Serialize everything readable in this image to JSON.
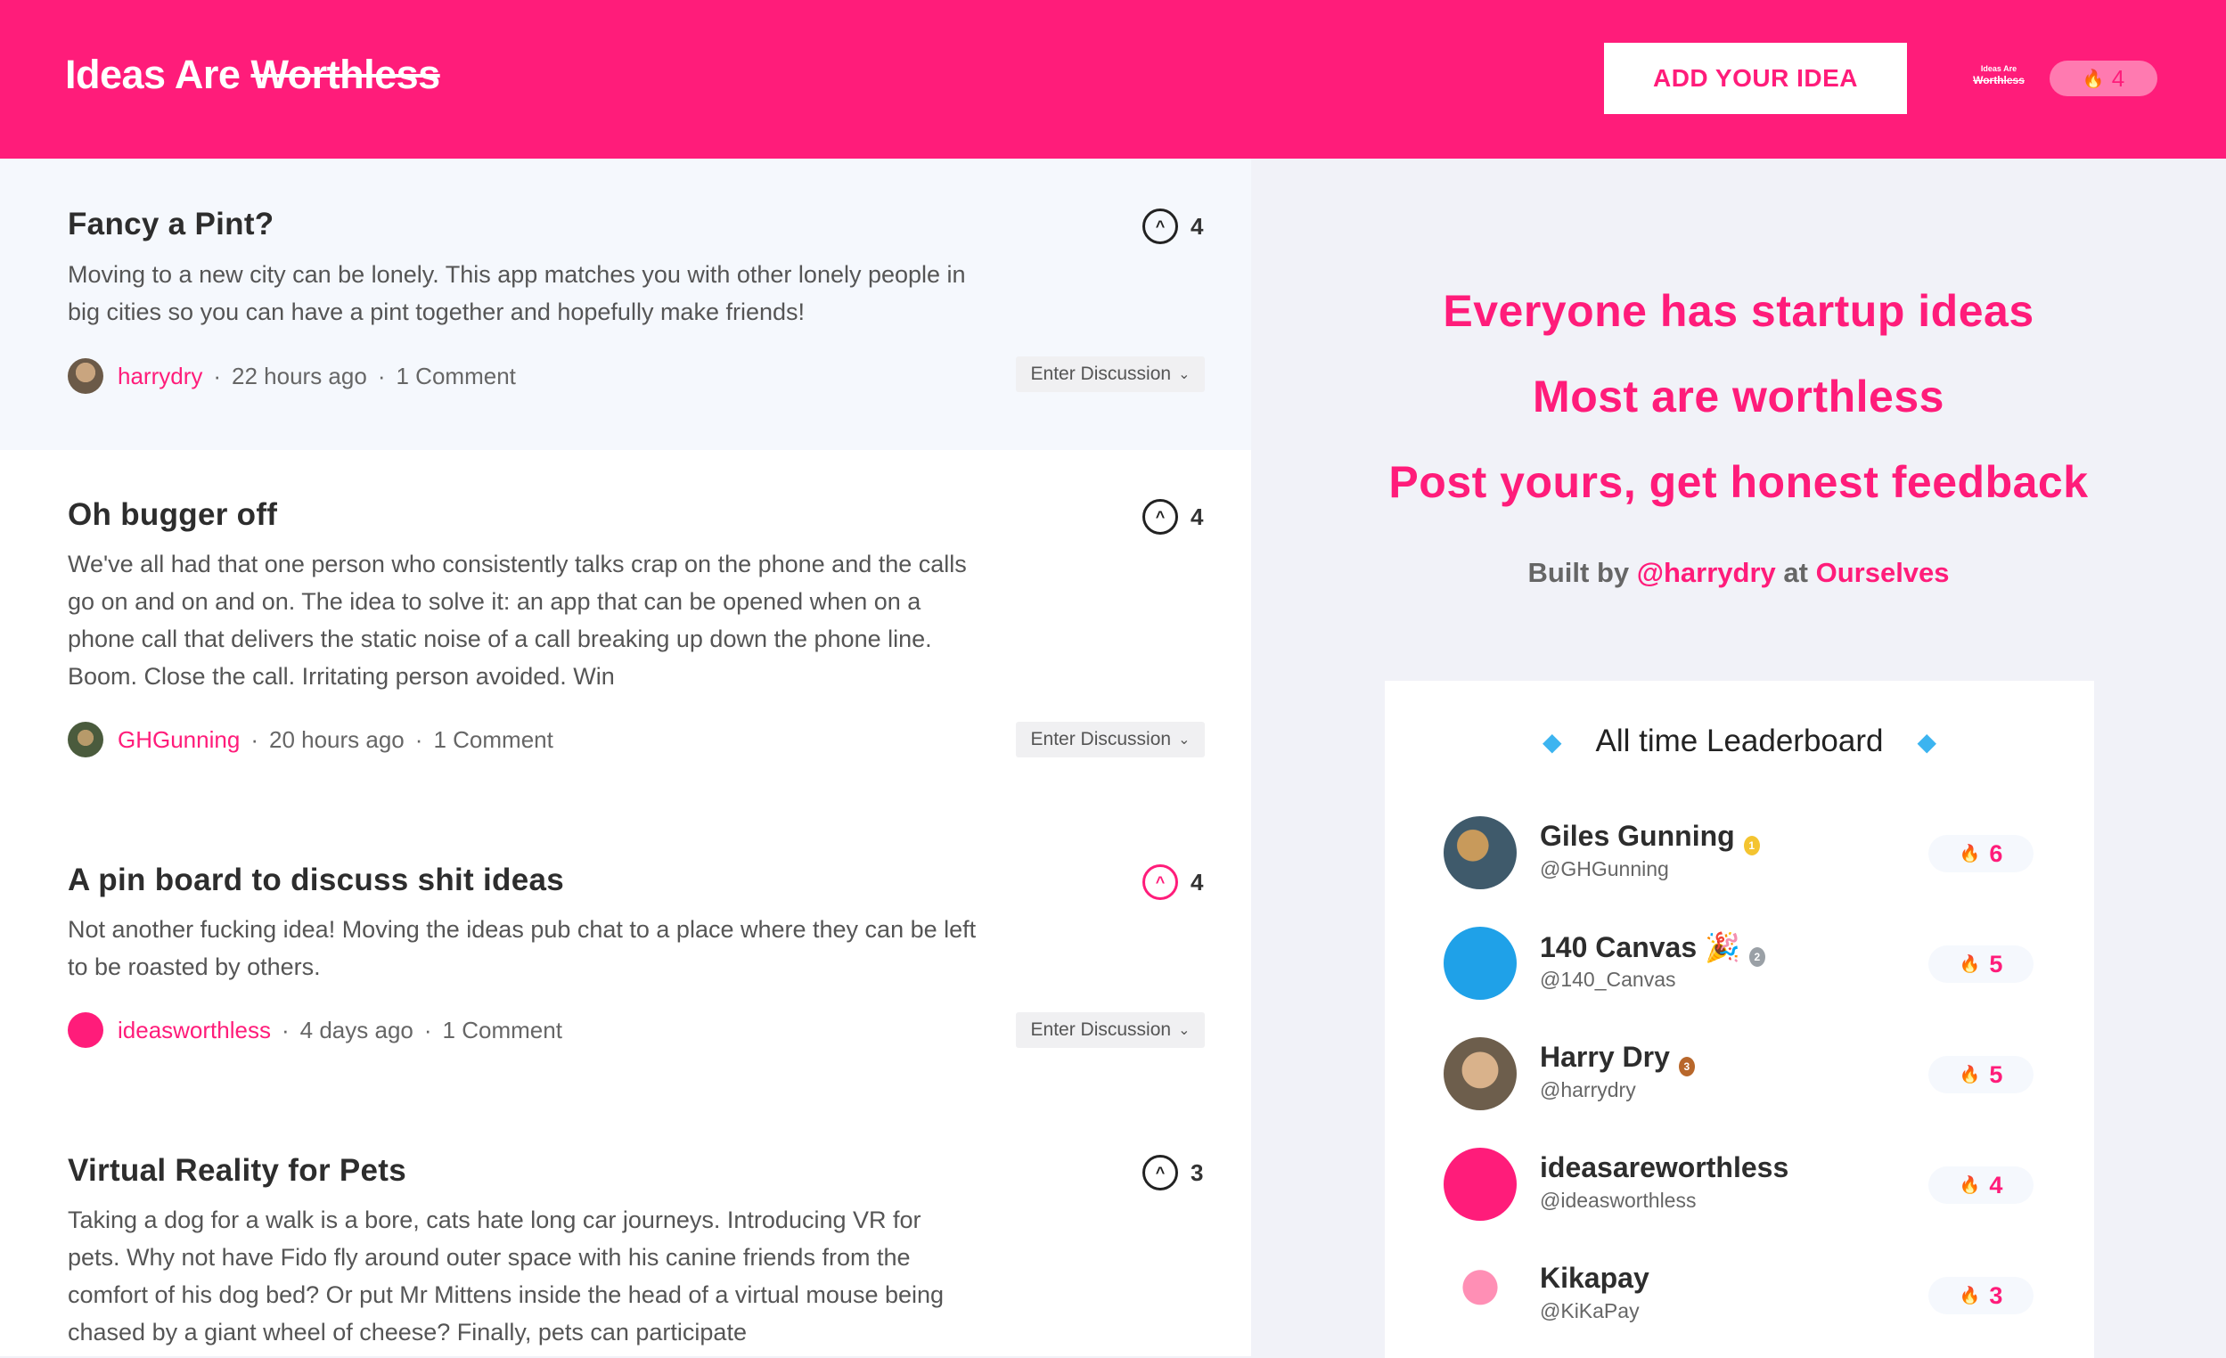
{
  "header": {
    "logo_plain": "Ideas Are",
    "logo_strike": "Worthless",
    "add_idea_label": "ADD YOUR IDEA",
    "mini_logo_l1": "Ideas Are",
    "mini_logo_l2": "Worthless",
    "user_score": "4",
    "fire_glyph": "🔥"
  },
  "ideas": [
    {
      "title": "Fancy a Pint?",
      "body": "Moving to a new city can be lonely. This app matches you with other lonely people in big cities so you can have a pint together and hopefully make friends!",
      "votes": "4",
      "author": "harrydry",
      "time": "22 hours ago",
      "comments": "1 Comment",
      "enter_label": "Enter Discussion",
      "voted": false
    },
    {
      "title": "Oh bugger off",
      "body": "We've all had that one person who consistently talks crap on the phone and the calls go on and on and on. The idea to solve it: an app that can be opened when on a phone call that delivers the static noise of a call breaking up down the phone line. Boom. Close the call. Irritating person avoided. Win",
      "votes": "4",
      "author": "GHGunning",
      "time": "20 hours ago",
      "comments": "1 Comment",
      "enter_label": "Enter Discussion",
      "voted": false
    },
    {
      "title": "A pin board to discuss shit ideas",
      "body": "Not another fucking idea! Moving the ideas pub chat to a place where they can be left to be roasted by others.",
      "votes": "4",
      "author": "ideasworthless",
      "time": "4 days ago",
      "comments": "1 Comment",
      "enter_label": "Enter Discussion",
      "voted": true
    },
    {
      "title": "Virtual Reality for Pets",
      "body": "Taking a dog for a walk is a bore, cats hate long car journeys. Introducing VR for pets. Why not have Fido fly around outer space with his canine friends from the comfort of his dog bed? Or put Mr Mittens inside the head of a virtual mouse being chased by a giant wheel of cheese? Finally, pets can participate",
      "votes": "3",
      "voted": false
    }
  ],
  "tagline": {
    "line1": "Everyone has startup ideas",
    "line2": "Most are worthless",
    "line3": "Post yours, get honest feedback",
    "built_by": "Built by",
    "built_user": "@harrydry",
    "built_at": "at",
    "built_company": "Ourselves"
  },
  "leaderboard": {
    "title": "All time Leaderboard",
    "entries": [
      {
        "name": "Giles Gunning",
        "handle": "@GHGunning",
        "score": "6",
        "medal": "1"
      },
      {
        "name": "140 Canvas",
        "emoji": "🎉",
        "handle": "@140_Canvas",
        "score": "5",
        "medal": "2"
      },
      {
        "name": "Harry Dry",
        "handle": "@harrydry",
        "score": "5",
        "medal": "3"
      },
      {
        "name": "ideasareworthless",
        "handle": "@ideasworthless",
        "score": "4"
      },
      {
        "name": "Kikapay",
        "handle": "@KiKaPay",
        "score": "3"
      }
    ]
  },
  "colors": {
    "brand": "#ff1c7a",
    "pill": "#ff7ab0",
    "panel": "#f1f2f8"
  }
}
